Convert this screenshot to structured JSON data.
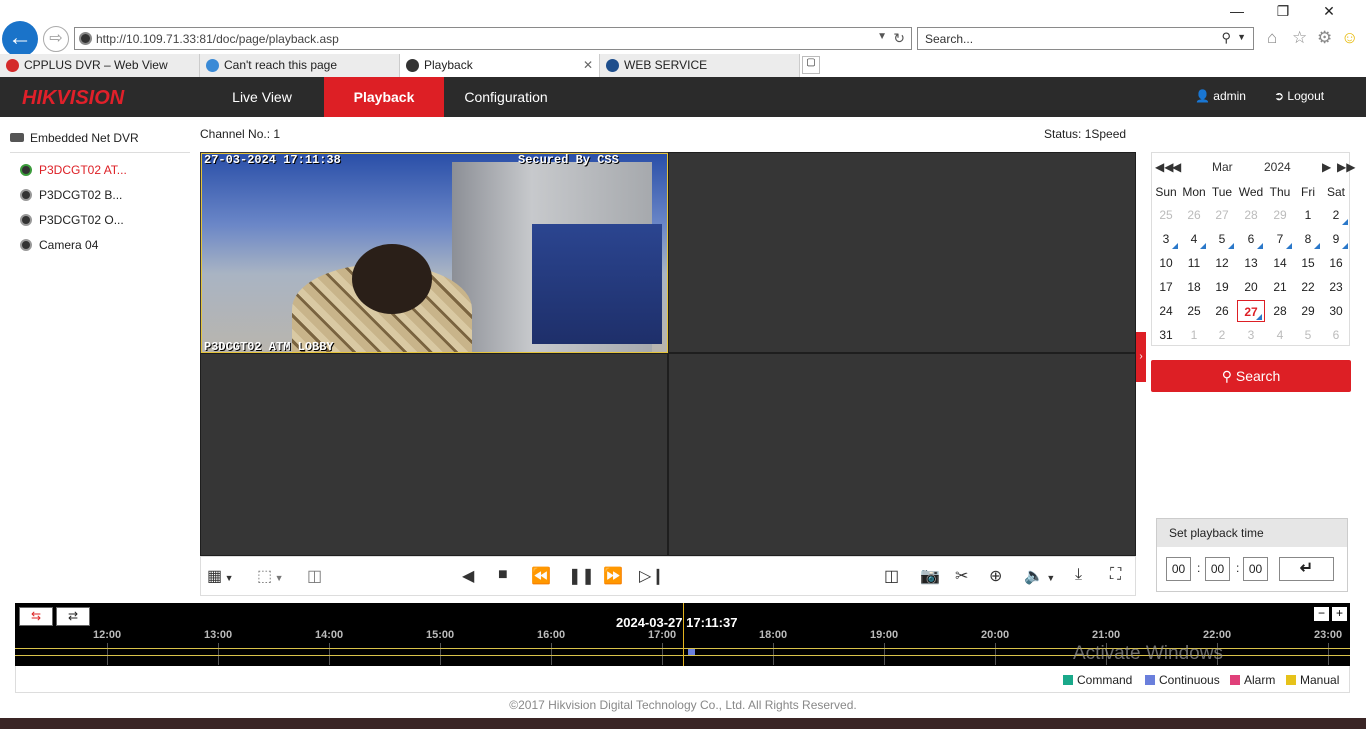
{
  "browser": {
    "url": "http://10.109.71.33:81/doc/page/playback.asp",
    "search_placeholder": "Search...",
    "tabs": [
      {
        "label": "CPPLUS DVR – Web View"
      },
      {
        "label": "Can't reach this page"
      },
      {
        "label": "Playback"
      },
      {
        "label": "WEB SERVICE"
      }
    ]
  },
  "app": {
    "logo": "HIKVISION",
    "nav": [
      "Live View",
      "Playback",
      "Configuration"
    ],
    "user": "admin",
    "logout": "Logout"
  },
  "tree": {
    "root": "Embedded Net DVR",
    "cameras": [
      "P3DCGT02 AT...",
      "P3DCGT02 B...",
      "P3DCGT02 O...",
      "Camera 04"
    ]
  },
  "playback": {
    "channel": "Channel No.: 1",
    "status": "Status: 1Speed",
    "osd_time": "27-03-2024 17:11:38",
    "osd_secured": "Secured By CSS",
    "osd_name": "P3DCGT02 ATM LOBBY"
  },
  "calendar": {
    "month": "Mar",
    "year": "2024",
    "weekdays": [
      "Sun",
      "Mon",
      "Tue",
      "Wed",
      "Thu",
      "Fri",
      "Sat"
    ],
    "weeks": [
      [
        "25",
        "26",
        "27",
        "28",
        "29",
        "1",
        "2"
      ],
      [
        "3",
        "4",
        "5",
        "6",
        "7",
        "8",
        "9"
      ],
      [
        "10",
        "11",
        "12",
        "13",
        "14",
        "15",
        "16"
      ],
      [
        "17",
        "18",
        "19",
        "20",
        "21",
        "22",
        "23"
      ],
      [
        "24",
        "25",
        "26",
        "27",
        "28",
        "29",
        "30"
      ],
      [
        "31",
        "1",
        "2",
        "3",
        "4",
        "5",
        "6"
      ]
    ],
    "selected_day": "27"
  },
  "search_label": "Search",
  "set_time": {
    "title": "Set playback time",
    "hh": "00",
    "mm": "00",
    "ss": "00",
    "sep": ":"
  },
  "timeline": {
    "current": "2024-03-27 17:11:37",
    "ticks": [
      "12:00",
      "13:00",
      "14:00",
      "15:00",
      "16:00",
      "17:00",
      "18:00",
      "19:00",
      "20:00",
      "21:00",
      "22:00",
      "23:00"
    ]
  },
  "legend": [
    {
      "label": "Command",
      "color": "#1aa98a"
    },
    {
      "label": "Continuous",
      "color": "#6a7fdc"
    },
    {
      "label": "Alarm",
      "color": "#e0407a"
    },
    {
      "label": "Manual",
      "color": "#e6c21a"
    }
  ],
  "copyright": "©2017 Hikvision Digital Technology Co., Ltd. All Rights Reserved.",
  "watermark": "Activate Windows"
}
